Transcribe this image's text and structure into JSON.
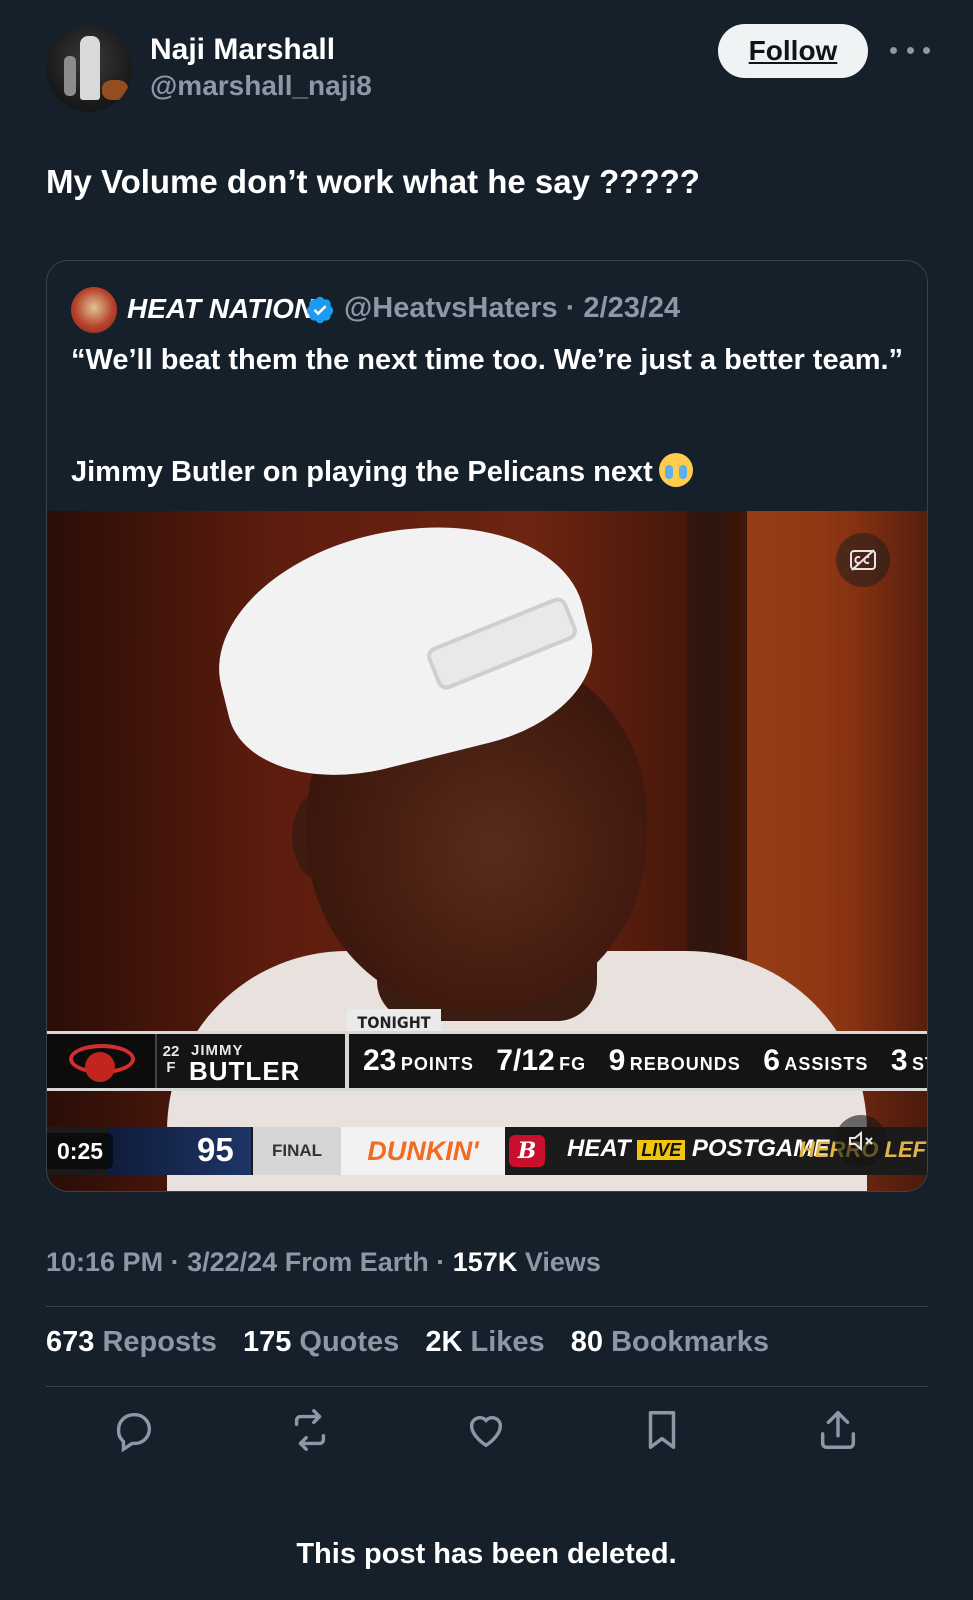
{
  "author": {
    "display_name": "Naji Marshall",
    "handle": "@marshall_naji8"
  },
  "header": {
    "follow_label": "Follow",
    "more_icon": "more-horizontal-icon"
  },
  "post": {
    "text": "My Volume don’t work what he say ?????"
  },
  "quoted_post": {
    "display_name": "HEAT NATION",
    "handle_date": "@HeatvsHaters · 2/23/24",
    "verified_color": "#1d9bf0",
    "text_line1": "“We’ll beat them the next time too. We’re just a better team.”",
    "text_line2": "Jimmy Butler on playing the Pelicans next",
    "video": {
      "tonight_label": "TONIGHT",
      "jersey_number": "22",
      "position": "F",
      "first_name": "JIMMY",
      "last_name": "BUTLER",
      "stats": [
        {
          "value": "23",
          "label": "POINTS"
        },
        {
          "value": "7/12",
          "label": "FG"
        },
        {
          "value": "9",
          "label": "REBOUNDS"
        },
        {
          "value": "6",
          "label": "ASSISTS"
        },
        {
          "value": "3",
          "label": "STE/"
        }
      ],
      "ticker": {
        "score": "95",
        "final_label": "FINAL",
        "sponsor": "DUNKIN'",
        "b_logo": "B",
        "postgame_pre": "HEAT",
        "live_label": "LIVE",
        "postgame_post": "POSTGAME",
        "herro": "HERRO LEFT G"
      },
      "timestamp": "0:25"
    }
  },
  "meta": {
    "time": "10:16 PM",
    "date": "3/22/24",
    "source": "From Earth",
    "views_count": "157K",
    "views_label": "Views",
    "sep": "·"
  },
  "engagement": {
    "reposts_count": "673",
    "reposts_label": "Reposts",
    "quotes_count": "175",
    "quotes_label": "Quotes",
    "likes_count": "2K",
    "likes_label": "Likes",
    "bookmarks_count": "80",
    "bookmarks_label": "Bookmarks"
  },
  "footer": {
    "deleted_notice": "This post has been deleted."
  }
}
